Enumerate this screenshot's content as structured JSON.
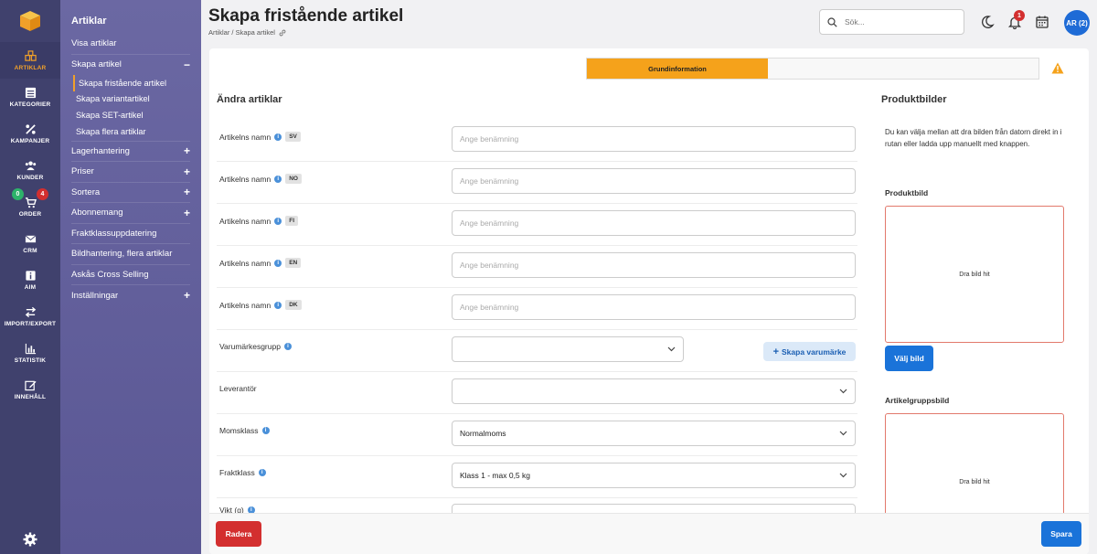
{
  "rail": {
    "items": [
      {
        "label": "ARTIKLAR",
        "icon": "box-icon"
      },
      {
        "label": "KATEGORIER",
        "icon": "list-icon"
      },
      {
        "label": "KAMPANJER",
        "icon": "percent-icon"
      },
      {
        "label": "KUNDER",
        "icon": "users-icon"
      },
      {
        "label": "ORDER",
        "icon": "cart-icon",
        "badge_green": "0",
        "badge_red": "4"
      },
      {
        "label": "CRM",
        "icon": "mail-icon"
      },
      {
        "label": "AIM",
        "icon": "info-icon"
      },
      {
        "label": "IMPORT/EXPORT",
        "icon": "swap-icon"
      },
      {
        "label": "STATISTIK",
        "icon": "chart-icon"
      },
      {
        "label": "INNEHÅLL",
        "icon": "edit-icon"
      }
    ],
    "accent": "#f0a02a"
  },
  "menu": {
    "title": "Artiklar",
    "items": [
      {
        "label": "Visa artiklar",
        "toggle": ""
      },
      {
        "label": "Skapa artikel",
        "toggle": "−"
      },
      {
        "label": "Lagerhantering",
        "toggle": "+"
      },
      {
        "label": "Priser",
        "toggle": "+"
      },
      {
        "label": "Sortera",
        "toggle": "+"
      },
      {
        "label": "Abonnemang",
        "toggle": "+"
      },
      {
        "label": "Fraktklassuppdatering",
        "toggle": ""
      },
      {
        "label": "Bildhantering, flera artiklar",
        "toggle": ""
      },
      {
        "label": "Askås Cross Selling",
        "toggle": ""
      },
      {
        "label": "Inställningar",
        "toggle": "+"
      }
    ],
    "subitems": [
      "Skapa fristående artikel",
      "Skapa variantartikel",
      "Skapa SET-artikel",
      "Skapa flera artiklar"
    ]
  },
  "header": {
    "title": "Skapa fristående artikel",
    "breadcrumb": "Artiklar / Skapa artikel",
    "search_placeholder": "Sök...",
    "notification_count": "1",
    "avatar": "AR (2)"
  },
  "tabs": {
    "active": "Grundinformation"
  },
  "form": {
    "heading": "Ändra artiklar",
    "name_rows": [
      {
        "label": "Artikelns namn",
        "lang": "SV",
        "placeholder": "Ange benämning"
      },
      {
        "label": "Artikelns namn",
        "lang": "NO",
        "placeholder": "Ange benämning"
      },
      {
        "label": "Artikelns namn",
        "lang": "FI",
        "placeholder": "Ange benämning"
      },
      {
        "label": "Artikelns namn",
        "lang": "EN",
        "placeholder": "Ange benämning"
      },
      {
        "label": "Artikelns namn",
        "lang": "DK",
        "placeholder": "Ange benämning"
      }
    ],
    "brand_group": {
      "label": "Varumärkesgrupp",
      "value": "",
      "button": "Skapa varumärke"
    },
    "supplier": {
      "label": "Leverantör",
      "value": ""
    },
    "vat": {
      "label": "Momsklass",
      "value": "Normalmoms"
    },
    "freight": {
      "label": "Fraktklass",
      "value": "Klass 1 - max 0,5 kg"
    },
    "weight": {
      "label": "Vikt (g)"
    }
  },
  "images": {
    "heading": "Produktbilder",
    "help": "Du kan välja mellan att dra bilden från datorn direkt in i rutan eller ladda upp manuellt med knappen.",
    "product_label": "Produktbild",
    "drop_text": "Dra bild hit",
    "pick_button": "Välj bild",
    "group_label": "Artikelgruppsbild",
    "group_drop_text": "Dra bild hit"
  },
  "footer": {
    "delete": "Radera",
    "save": "Spara"
  }
}
